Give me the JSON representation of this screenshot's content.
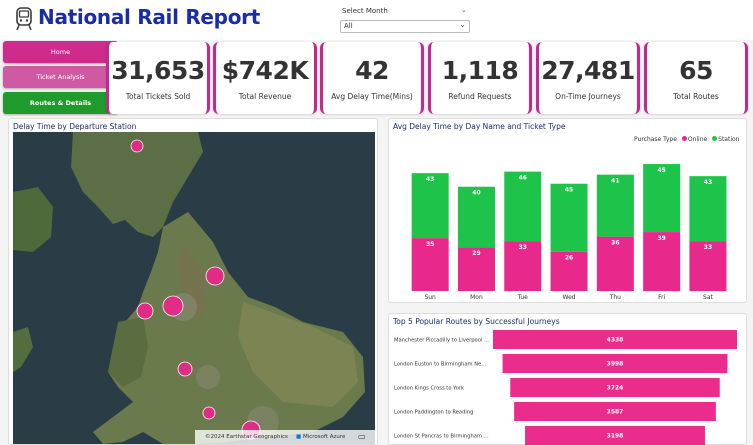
{
  "header": {
    "title": "National Rail Report",
    "month_filter_label": "Select Month",
    "month_filter_value": "All"
  },
  "nav": {
    "home": "Home",
    "ticket_analysis": "Ticket Analysis",
    "routes_details": "Routes & Details"
  },
  "kpis": [
    {
      "value": "31,653",
      "label": "Total Tickets Sold"
    },
    {
      "value": "$742K",
      "label": "Total Revenue"
    },
    {
      "value": "42",
      "label": "Avg Delay Time(Mins)"
    },
    {
      "value": "1,118",
      "label": "Refund Requests"
    },
    {
      "value": "27,481",
      "label": "On-Time Journeys"
    },
    {
      "value": "65",
      "label": "Total Routes"
    }
  ],
  "map": {
    "title": "Delay Time by Departure Station",
    "credit": "©2024 Earthstar Geographics",
    "provider": "Microsoft Azure"
  },
  "chart_data": [
    {
      "type": "bar",
      "stacked": true,
      "title": "Avg Delay Time by Day Name and Ticket Type",
      "legend_title": "Purchase Type",
      "legend_position": "top-right",
      "categories": [
        "Sun",
        "Mon",
        "Tue",
        "Wed",
        "Thu",
        "Fri",
        "Sat"
      ],
      "series": [
        {
          "name": "Online",
          "color": "#e8288a",
          "values": [
            35,
            29,
            33,
            26,
            36,
            39,
            33
          ]
        },
        {
          "name": "Station",
          "color": "#1ec44a",
          "values": [
            43,
            40,
            46,
            45,
            41,
            45,
            43
          ]
        }
      ]
    },
    {
      "type": "bar",
      "orientation": "horizontal",
      "title": "Top 5 Popular Routes by Successful Journeys",
      "color": "#ec2c8c",
      "categories": [
        "Manchester Piccadilly to Liverpool ...",
        "London Euston to Birmingham Ne...",
        "London Kings Cross to York",
        "London Paddington to Reading",
        "London St Pancras to Birmingham ..."
      ],
      "values": [
        4338,
        3998,
        3724,
        3587,
        3198
      ]
    }
  ],
  "map_points": [
    {
      "name": "Edinburgh area",
      "size": "small"
    },
    {
      "name": "York area",
      "size": "medium"
    },
    {
      "name": "Manchester area",
      "size": "large"
    },
    {
      "name": "Liverpool area",
      "size": "medium"
    },
    {
      "name": "Birmingham area",
      "size": "small"
    },
    {
      "name": "Bristol area",
      "size": "small"
    },
    {
      "name": "London area",
      "size": "medium"
    }
  ],
  "colors": {
    "brand_blue": "#1a2da3",
    "accent_pink": "#c4288e",
    "online": "#e8288a",
    "station": "#1ec44a",
    "nav_green": "#1f9a2c"
  }
}
